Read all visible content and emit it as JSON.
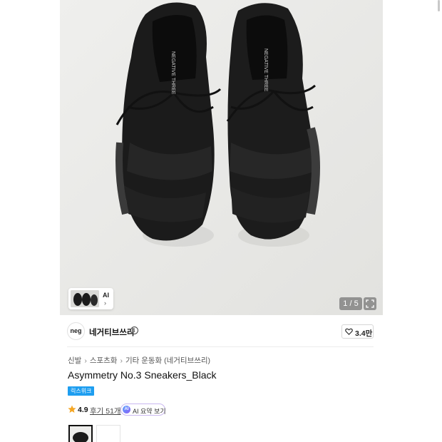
{
  "gallery": {
    "image_alt": "Black sneakers top view",
    "counter": "1 / 5",
    "ai_chip_label": "AI",
    "chevron": "›",
    "icons": {
      "expand": "expand-icon",
      "chevron": "chevron-right-icon"
    }
  },
  "brand": {
    "logo_text": "neg",
    "name": "네거티브쓰리",
    "likes": "3.4만",
    "icons": {
      "info": "info-icon",
      "heart": "heart-icon"
    }
  },
  "breadcrumb": {
    "items": [
      "신발",
      "스포츠화",
      "기타 운동화 (네거티브쓰리)"
    ],
    "separator": "›"
  },
  "product": {
    "title": "Asymmetry No.3 Sneakers_Black",
    "badge": "릭스위크",
    "rating": "4.9",
    "reviews": "후기 51개",
    "ai_summary": "AI 요약 보기"
  },
  "colors": {
    "badge": "#1e9ef0",
    "star": "#f5a623",
    "ai_border": "#c9b8f0"
  }
}
